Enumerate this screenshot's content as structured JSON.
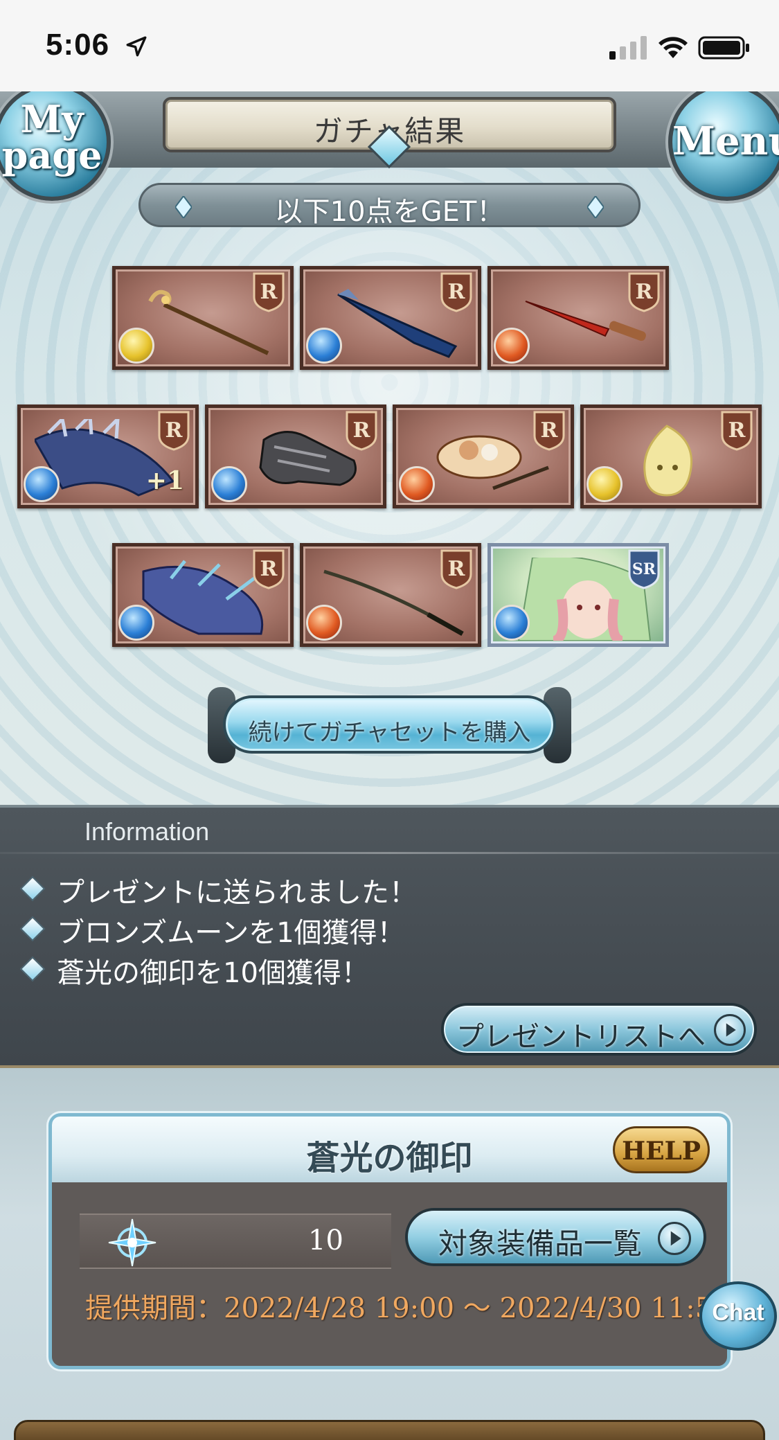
{
  "status_bar": {
    "time": "5:06"
  },
  "header": {
    "title": "ガチャ結果",
    "mypage_label_1": "My",
    "mypage_label_2": "page",
    "menu_label": "Menu"
  },
  "result": {
    "banner": "以下10点をGET！",
    "items": [
      {
        "rarity": "R",
        "element": "light",
        "icon": "staff-weapon"
      },
      {
        "rarity": "R",
        "element": "water",
        "icon": "gun-weapon"
      },
      {
        "rarity": "R",
        "element": "fire",
        "icon": "dagger-weapon"
      },
      {
        "rarity": "R",
        "element": "water",
        "icon": "dragon-summon",
        "plus": "+1"
      },
      {
        "rarity": "R",
        "element": "water",
        "icon": "gauntlet-weapon"
      },
      {
        "rarity": "R",
        "element": "fire",
        "icon": "ramen-summon"
      },
      {
        "rarity": "R",
        "element": "light",
        "icon": "spirit-summon"
      },
      {
        "rarity": "R",
        "element": "water",
        "icon": "sea-dragon-summon"
      },
      {
        "rarity": "R",
        "element": "fire",
        "icon": "katana-weapon"
      },
      {
        "rarity": "SR",
        "element": "water",
        "icon": "character-portrait"
      }
    ],
    "buy_again_button": "続けてガチャセットを購入"
  },
  "information": {
    "heading": "Information",
    "messages": [
      "プレゼントに送られました！",
      "ブロンズムーンを1個獲得！",
      "蒼光の御印を10個獲得！"
    ],
    "present_list_button": "プレゼントリストへ"
  },
  "seal": {
    "title": "蒼光の御印",
    "help_button": "HELP",
    "count": "10",
    "equipment_list_button": "対象装備品一覧",
    "period": "提供期間：2022/4/28 19:00 〜 2022/4/30 11:59"
  },
  "chat_button": "Chat"
}
